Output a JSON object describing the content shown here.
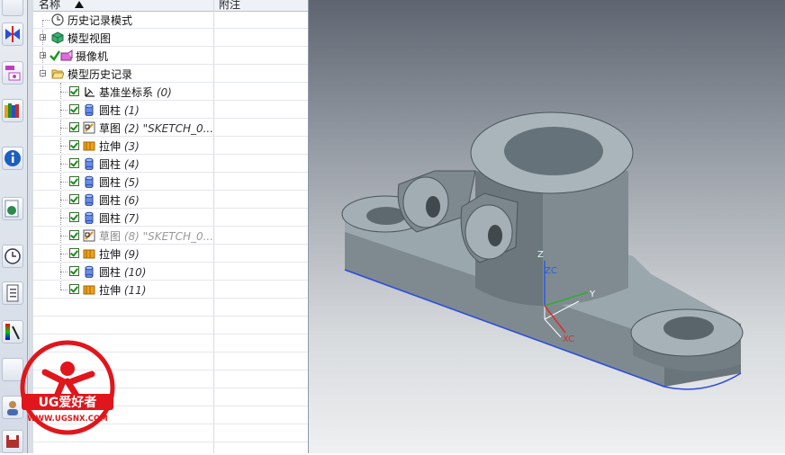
{
  "navigator": {
    "header": {
      "col_name": "名称",
      "col_attach": "附注"
    },
    "root": {
      "label": "历史记录模式"
    },
    "groups": [
      {
        "label": "模型视图"
      },
      {
        "label": "摄像机"
      },
      {
        "label": "模型历史记录"
      }
    ],
    "features": [
      {
        "name": "基准坐标系",
        "id": "(0)",
        "icon": "datum-csys-icon",
        "suppressed": false
      },
      {
        "name": "圆柱",
        "id": "(1)",
        "icon": "cylinder-icon",
        "suppressed": false
      },
      {
        "name": "草图",
        "id": "(2) \"SKETCH_0...",
        "icon": "sketch-icon",
        "suppressed": false
      },
      {
        "name": "拉伸",
        "id": "(3)",
        "icon": "extrude-icon",
        "suppressed": false
      },
      {
        "name": "圆柱",
        "id": "(4)",
        "icon": "cylinder-icon",
        "suppressed": false
      },
      {
        "name": "圆柱",
        "id": "(5)",
        "icon": "cylinder-icon",
        "suppressed": false
      },
      {
        "name": "圆柱",
        "id": "(6)",
        "icon": "cylinder-icon",
        "suppressed": false
      },
      {
        "name": "圆柱",
        "id": "(7)",
        "icon": "cylinder-icon",
        "suppressed": false
      },
      {
        "name": "草图",
        "id": "(8) \"SKETCH_0...",
        "icon": "sketch-icon",
        "suppressed": true
      },
      {
        "name": "拉伸",
        "id": "(9)",
        "icon": "extrude-icon",
        "suppressed": false
      },
      {
        "name": "圆柱",
        "id": "(10)",
        "icon": "cylinder-icon",
        "suppressed": false
      },
      {
        "name": "拉伸",
        "id": "(11)",
        "icon": "extrude-icon",
        "suppressed": false
      }
    ]
  },
  "viewport": {
    "triad": {
      "z": "Z",
      "zc": "ZC",
      "y": "Y",
      "xc": "XC"
    }
  },
  "watermark": {
    "brand": "UG爱好者",
    "url": "WWW.UGSNX.COM"
  },
  "colors": {
    "part": "#8a969c",
    "viewport_top": "#5e6570",
    "viewport_bottom": "#eef0f1",
    "check": "#1d8a1d",
    "watermark": "#e0161c"
  }
}
